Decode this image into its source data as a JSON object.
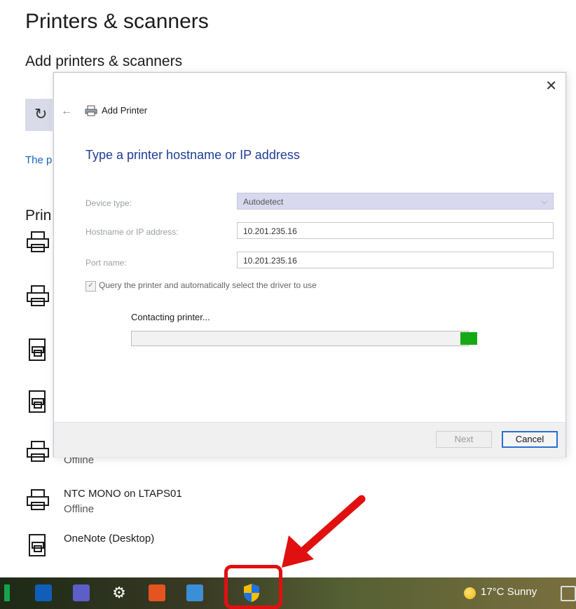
{
  "settings": {
    "page_title": "Printers & scanners",
    "section_title": "Add printers & scanners",
    "refresh_icon": "refresh-icon",
    "link_fragment": "The p",
    "list_header_fragment": "Prin",
    "behind_item_status": "Offline",
    "list_items": [
      {
        "name": "NTC MONO on LTAPS01",
        "status": "Offline",
        "icon": "printer-icon"
      },
      {
        "name": "OneNote (Desktop)",
        "status": "",
        "icon": "document-printer-icon"
      }
    ]
  },
  "dialog": {
    "title": "Add Printer",
    "heading": "Type a printer hostname or IP address",
    "close_icon": "close-icon",
    "back_icon": "back-arrow-icon",
    "device_type": {
      "label": "Device type:",
      "value": "Autodetect"
    },
    "hostname": {
      "label": "Hostname or IP address:",
      "value": "10.201.235.16"
    },
    "port_name": {
      "label": "Port name:",
      "value": "10.201.235.16"
    },
    "query_checkbox": {
      "label": "Query the printer and automatically select the driver to use",
      "checked": true
    },
    "status_text": "Contacting printer...",
    "buttons": {
      "next": "Next",
      "cancel": "Cancel"
    }
  },
  "taskbar": {
    "weather": "17°C  Sunny",
    "highlighted_icon": "uac-shield-icon",
    "colors": {
      "highlight": "#e01010",
      "arrow": "#e01010",
      "progress": "#15a915"
    }
  }
}
